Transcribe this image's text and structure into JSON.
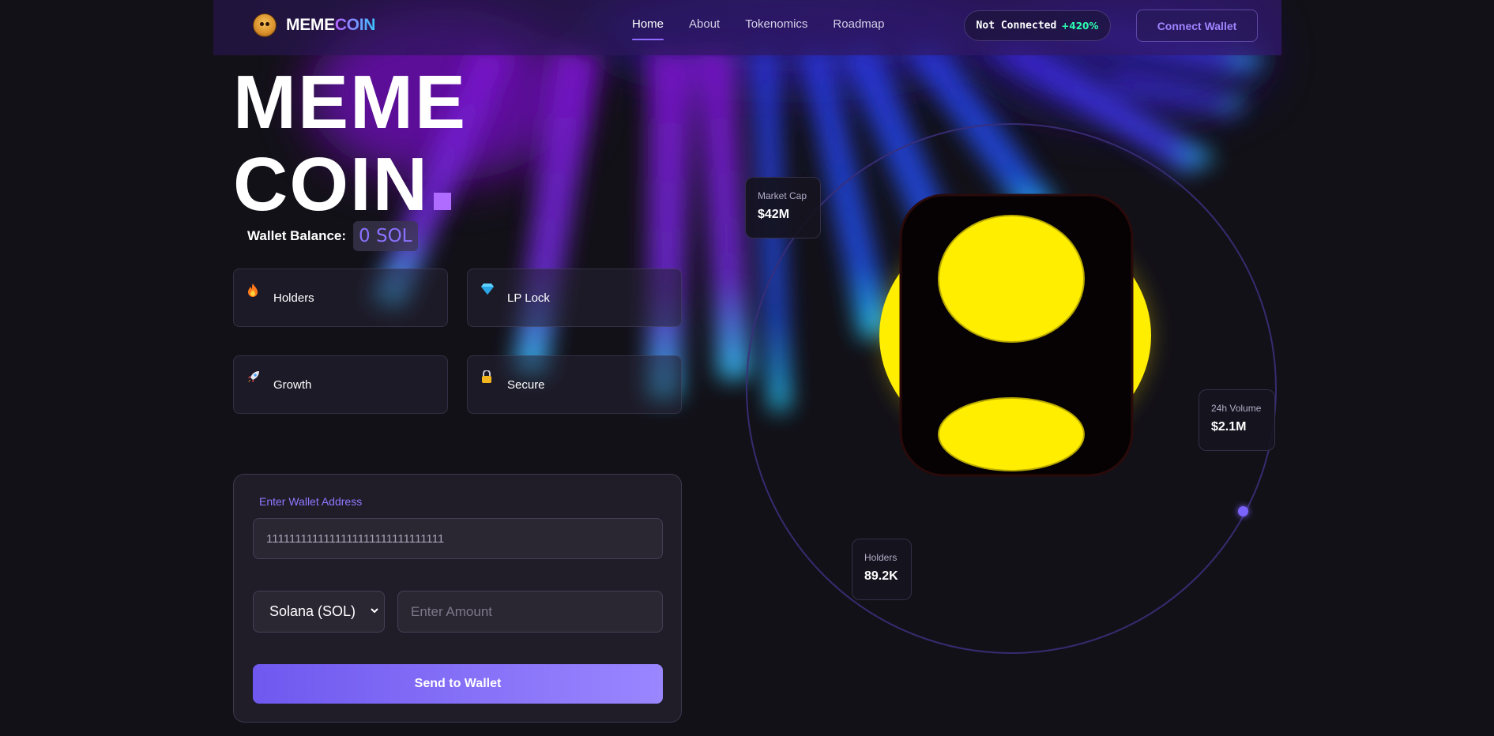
{
  "nav": {
    "logo_a": "MEME",
    "logo_b": "COIN",
    "links": [
      {
        "label": "Home",
        "active": true
      },
      {
        "label": "About"
      },
      {
        "label": "Tokenomics"
      },
      {
        "label": "Roadmap"
      }
    ],
    "status": {
      "label": "Not Connected",
      "change": "+420%"
    },
    "connect_label": "Connect Wallet"
  },
  "hero": {
    "line1": "MEME",
    "line2": "COIN",
    "balance_label": "Wallet Balance:",
    "balance_value": "0 SOL"
  },
  "features": [
    {
      "label": "Holders",
      "icon": "fire-icon"
    },
    {
      "label": "LP Lock",
      "icon": "diamond-icon"
    },
    {
      "label": "Growth",
      "icon": "rocket-icon"
    },
    {
      "label": "Secure",
      "icon": "lock-icon"
    }
  ],
  "form": {
    "address_label": "Enter Wallet Address",
    "address_value": "1111111111111111111111111111111",
    "token_selected": "Solana (SOL)",
    "amount_placeholder": "Enter Amount",
    "send_label": "Send to Wallet"
  },
  "stats": {
    "market_cap": {
      "label": "Market Cap",
      "value": "$42M"
    },
    "volume": {
      "label": "24h Volume",
      "value": "$2.1M"
    },
    "holders": {
      "label": "Holders",
      "value": "89.2K"
    }
  },
  "colors": {
    "accent": "#8e6bff",
    "positive": "#2dffb1",
    "coin_yellow": "#ffee00",
    "background": "#131118"
  }
}
